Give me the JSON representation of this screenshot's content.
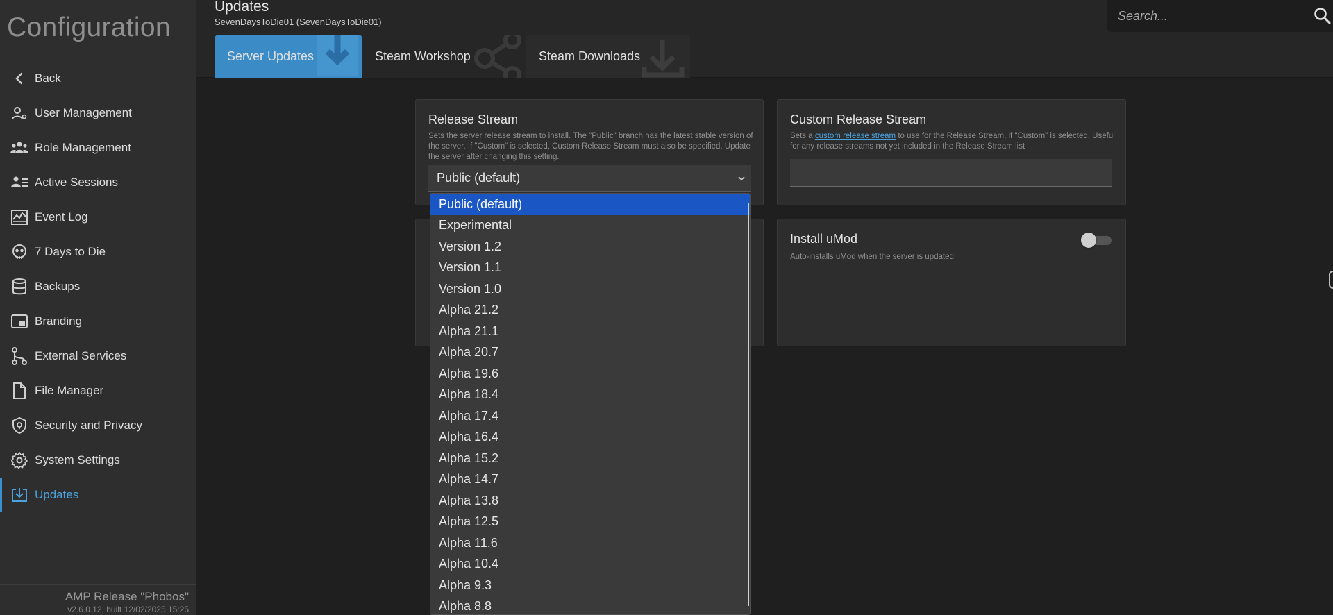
{
  "sidebar": {
    "title": "Configuration",
    "items": [
      {
        "label": "Back",
        "icon": "chevron-left-icon"
      },
      {
        "label": "User Management",
        "icon": "user-gear-icon"
      },
      {
        "label": "Role Management",
        "icon": "users-group-icon"
      },
      {
        "label": "Active Sessions",
        "icon": "user-list-icon"
      },
      {
        "label": "Event Log",
        "icon": "chart-line-icon"
      },
      {
        "label": "7 Days to Die",
        "icon": "skull-icon"
      },
      {
        "label": "Backups",
        "icon": "database-icon"
      },
      {
        "label": "Branding",
        "icon": "picture-in-picture-icon"
      },
      {
        "label": "External Services",
        "icon": "nodes-icon"
      },
      {
        "label": "File Manager",
        "icon": "file-icon"
      },
      {
        "label": "Security and Privacy",
        "icon": "shield-lock-icon"
      },
      {
        "label": "System Settings",
        "icon": "gear-icon"
      },
      {
        "label": "Updates",
        "icon": "download-box-icon",
        "active": true
      }
    ],
    "footer": {
      "release": "AMP Release \"Phobos\"",
      "version": "v2.6.0.12, built 12/02/2025 15:25"
    }
  },
  "header": {
    "title": "Updates",
    "subtitle": "SevenDaysToDie01 (SevenDaysToDie01)",
    "search_placeholder": "Search...",
    "tabs": [
      {
        "label": "Server Updates",
        "active": true
      },
      {
        "label": "Steam Workshop"
      },
      {
        "label": "Steam Downloads"
      }
    ]
  },
  "cards": {
    "release_stream": {
      "title": "Release Stream",
      "desc": "Sets the server release stream to install. The \"Public\" branch has the latest stable version of the server. If \"Custom\" is selected, Custom Release Stream must also be specified. Update the server after changing this setting.",
      "selected": "Public (default)"
    },
    "custom_release_stream": {
      "title": "Custom Release Stream",
      "desc_prefix": "Sets a ",
      "desc_link": "custom release stream",
      "desc_suffix": " to use for the Release Stream, if \"Custom\" is selected. Useful for any release streams not yet included in the Release Stream list",
      "value": ""
    },
    "install_umod": {
      "title": "Install uMod",
      "desc": "Auto-installs uMod when the server is updated.",
      "enabled": false
    }
  },
  "dropdown": {
    "options": [
      "Public (default)",
      "Experimental",
      "Version 1.2",
      "Version 1.1",
      "Version 1.0",
      "Alpha 21.2",
      "Alpha 21.1",
      "Alpha 20.7",
      "Alpha 19.6",
      "Alpha 18.4",
      "Alpha 17.4",
      "Alpha 16.4",
      "Alpha 15.2",
      "Alpha 14.7",
      "Alpha 13.8",
      "Alpha 12.5",
      "Alpha 11.6",
      "Alpha 10.4",
      "Alpha 9.3",
      "Alpha 8.8"
    ],
    "selected_index": 0
  },
  "colors": {
    "accent": "#3b8bc7",
    "selected_option": "#1a56c4",
    "link": "#4aa3df"
  }
}
